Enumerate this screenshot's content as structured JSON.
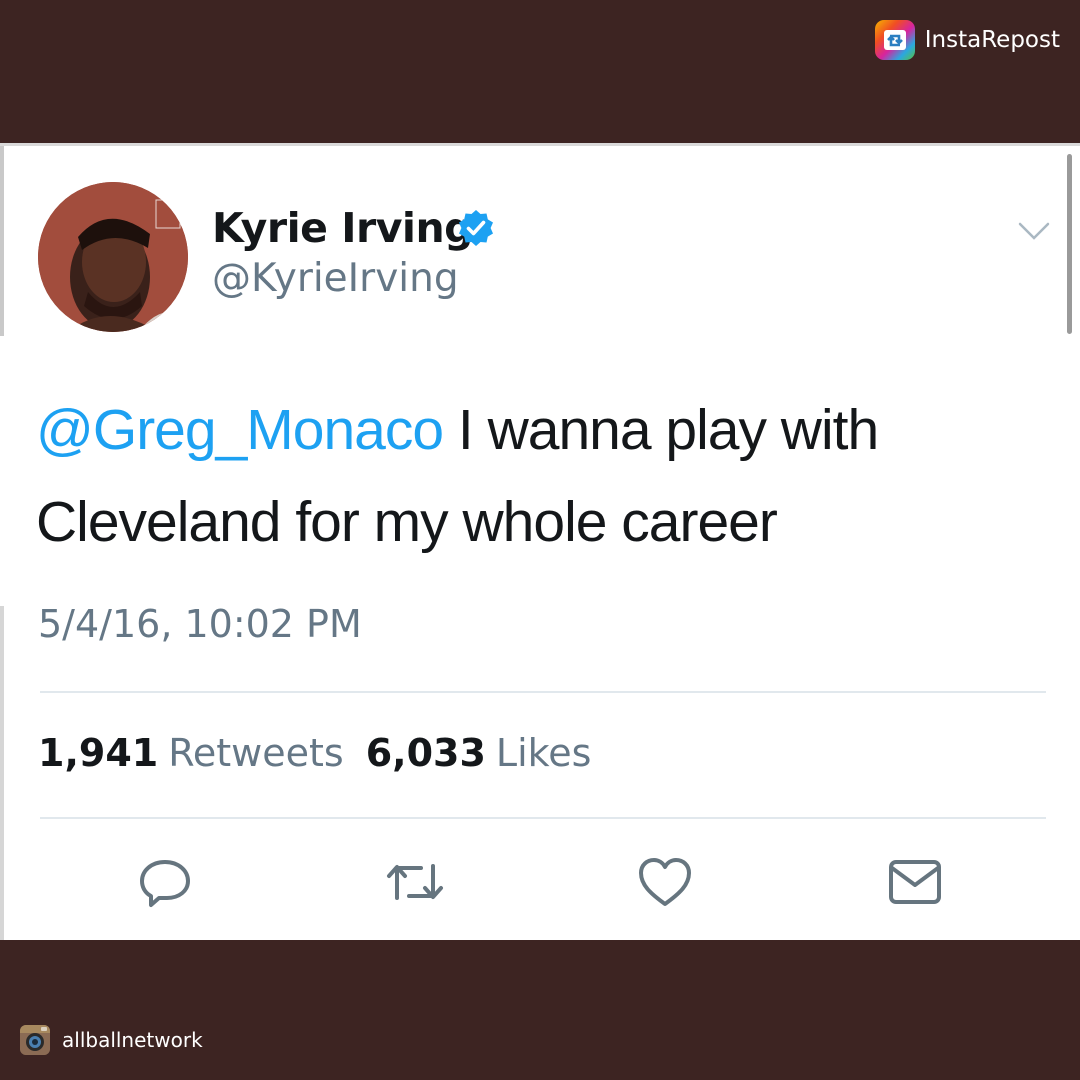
{
  "repost": {
    "app_name": "InstaRepost",
    "icon": "repost-icon"
  },
  "tweet": {
    "author": {
      "display_name": "Kyrie Irving",
      "handle": "@KyrieIrving",
      "verified": true,
      "avatar": "profile-photo"
    },
    "text": {
      "mention": "@Greg_Monaco",
      "body": " I wanna play with Cleveland for my whole career"
    },
    "timestamp": "5/4/16, 10:02 PM",
    "stats": {
      "retweets_count": "1,941",
      "retweets_label": "Retweets",
      "likes_count": "6,033",
      "likes_label": "Likes"
    },
    "actions": [
      "reply-icon",
      "retweet-icon",
      "like-icon",
      "message-icon"
    ]
  },
  "credit": {
    "username": "allballnetwork",
    "icon": "instagram-icon"
  },
  "colors": {
    "frame": "#3d2422",
    "mention": "#1da1f2",
    "verified": "#1da1f2",
    "secondary_text": "#657786",
    "icon_stroke": "#66757f"
  }
}
